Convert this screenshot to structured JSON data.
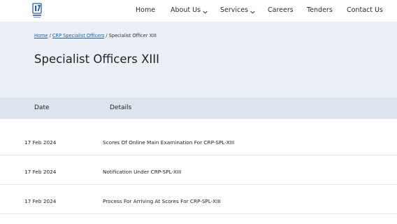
{
  "nav": {
    "logo_icon": "ibps-logo-icon",
    "items": [
      {
        "label": "Home",
        "dropdown": false
      },
      {
        "label": "About Us",
        "dropdown": true
      },
      {
        "label": "Services",
        "dropdown": true
      },
      {
        "label": "Careers",
        "dropdown": false
      },
      {
        "label": "Tenders",
        "dropdown": false
      },
      {
        "label": "Contact Us",
        "dropdown": false
      }
    ]
  },
  "breadcrumb": {
    "items": [
      "Home",
      "CRP Specialist Officers"
    ],
    "separator": "/",
    "current": "Specialist Officer XIII"
  },
  "page_title": "Specialist Officers XIII",
  "table": {
    "headers": {
      "date": "Date",
      "details": "Details"
    },
    "rows": [
      {
        "date": "17 Feb 2024",
        "detail": "Scores Of Online Main Examination For CRP-SPL-XIII"
      },
      {
        "date": "17 Feb 2024",
        "detail": "Notification Under CRP-SPL-XIII"
      },
      {
        "date": "17 Feb 2024",
        "detail": "Process For Arriving At Scores For CRP-SPL-XIII"
      }
    ]
  },
  "colors": {
    "hero_bg": "#e9eff4",
    "table_header_bg": "#dce5ed",
    "link": "#1f5fa6",
    "logo_blue": "#2a5aa8"
  }
}
